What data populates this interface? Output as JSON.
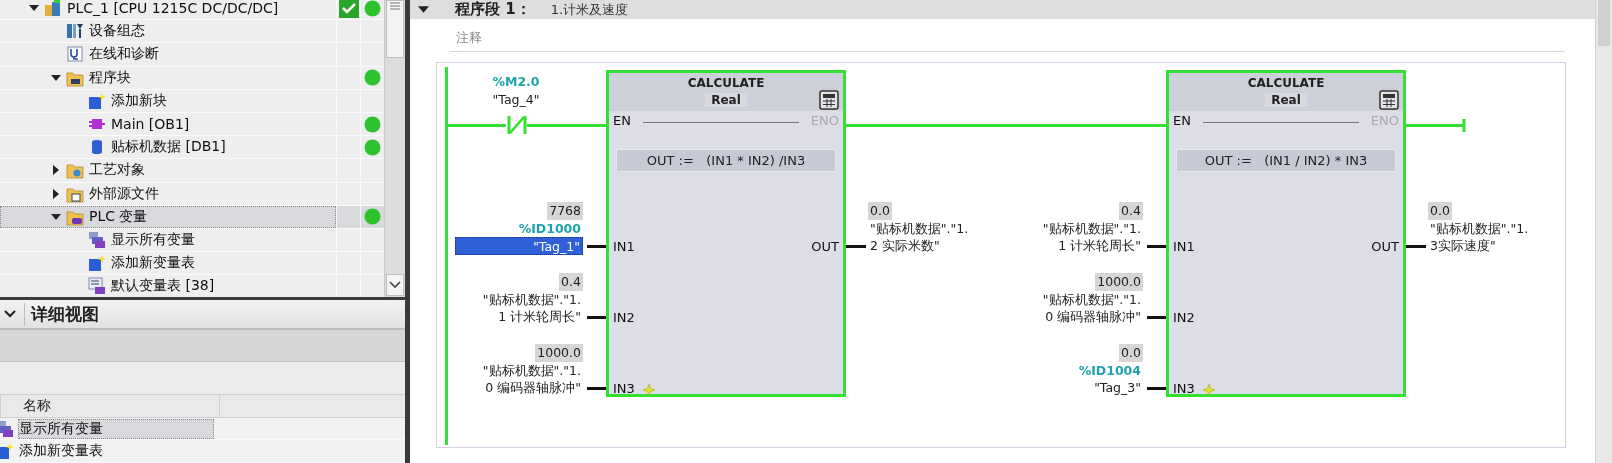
{
  "project_tree": {
    "items": [
      {
        "label": "PLC_1 [CPU 1215C DC/DC/DC]",
        "kind": "device",
        "expanded": true,
        "checked": true,
        "online": true,
        "selected": false,
        "children": [
          {
            "label": "设备组态",
            "kind": "config",
            "checked": false,
            "online": false,
            "selected": false
          },
          {
            "label": "在线和诊断",
            "kind": "diagnostics",
            "checked": false,
            "online": false,
            "selected": false
          },
          {
            "label": "程序块",
            "kind": "folder",
            "expanded": true,
            "checked": false,
            "online": true,
            "selected": false,
            "children": [
              {
                "label": "添加新块",
                "kind": "add",
                "checked": false,
                "online": false,
                "selected": false
              },
              {
                "label": "Main [OB1]",
                "kind": "ob",
                "checked": false,
                "online": true,
                "selected": false
              },
              {
                "label": "贴标机数据 [DB1]",
                "kind": "db",
                "checked": false,
                "online": true,
                "selected": false
              }
            ]
          },
          {
            "label": "工艺对象",
            "kind": "tech_folder",
            "expanded": false,
            "checked": false,
            "online": false,
            "selected": false
          },
          {
            "label": "外部源文件",
            "kind": "source_folder",
            "expanded": false,
            "checked": false,
            "online": false,
            "selected": false
          },
          {
            "label": "PLC 变量",
            "kind": "tag_folder",
            "expanded": true,
            "checked": false,
            "online": true,
            "selected": true,
            "children": [
              {
                "label": "显示所有变量",
                "kind": "show_tags",
                "checked": false,
                "online": false,
                "selected": false
              },
              {
                "label": "添加新变量表",
                "kind": "add",
                "checked": false,
                "online": false,
                "selected": false
              },
              {
                "label": "默认变量表 [38]",
                "kind": "tag_table",
                "checked": false,
                "online": false,
                "selected": false
              }
            ]
          }
        ]
      }
    ]
  },
  "details_view": {
    "title": "详细视图",
    "expanded": true,
    "columns": [
      "名称"
    ],
    "rows": [
      {
        "label": "显示所有变量",
        "kind": "show_tags",
        "selected": true
      },
      {
        "label": "添加新变量表",
        "kind": "add",
        "selected": false
      }
    ]
  },
  "network": {
    "label": "程序段 1：",
    "title": "1.计米及速度",
    "expanded": true,
    "comment_placeholder": "注释",
    "contact": {
      "kind": "normally_closed",
      "address": "%M2.0",
      "tag": "\"Tag_4\""
    },
    "blocks": [
      {
        "name": "CALCULATE",
        "type": "Real",
        "en": "EN",
        "eno": "ENO",
        "formula": "OUT :=   (IN1 * IN2) /IN3",
        "inputs": [
          {
            "pin": "IN1",
            "value": "7768",
            "address": "%ID1000",
            "tag_lines": [
              "\"Tag_1\""
            ],
            "selected": true
          },
          {
            "pin": "IN2",
            "value": "0.4",
            "tag_lines": [
              "\"贴标机数据\".\"1.",
              "1 计米轮周长\""
            ],
            "selected": false
          },
          {
            "pin": "IN3",
            "value": "1000.0",
            "tag_lines": [
              "\"贴标机数据\".\"1.",
              "0 编码器轴脉冲\""
            ],
            "selected": false
          }
        ],
        "output": {
          "pin": "OUT",
          "value": "0.0",
          "tag_lines": [
            "\"贴标机数据\".\"1.",
            "2 实际米数\""
          ]
        }
      },
      {
        "name": "CALCULATE",
        "type": "Real",
        "en": "EN",
        "eno": "ENO",
        "formula": "OUT :=   (IN1 / IN2) * IN3",
        "inputs": [
          {
            "pin": "IN1",
            "value": "0.4",
            "tag_lines": [
              "\"贴标机数据\".\"1.",
              "1 计米轮周长\""
            ],
            "selected": false
          },
          {
            "pin": "IN2",
            "value": "1000.0",
            "tag_lines": [
              "\"贴标机数据\".\"1.",
              "0 编码器轴脉冲\""
            ],
            "selected": false
          },
          {
            "pin": "IN3",
            "value": "0.0",
            "address": "%ID1004",
            "tag_lines": [
              "\"Tag_3\""
            ],
            "selected": false
          }
        ],
        "output": {
          "pin": "OUT",
          "value": "0.0",
          "tag_lines": [
            "\"贴标机数据\".\"1.",
            "3实际速度\""
          ]
        }
      }
    ]
  }
}
